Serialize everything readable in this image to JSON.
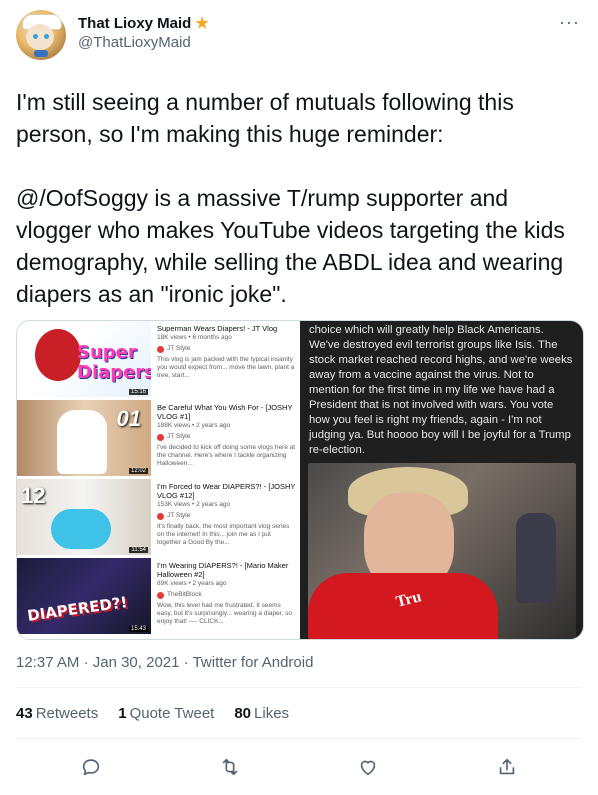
{
  "author": {
    "name": "That Lioxy Maid",
    "badge_icon": "star-icon",
    "handle": "@ThatLioxyMaid"
  },
  "more_icon": "more-icon",
  "tweet_text": "I'm still seeing a number of mutuals following this person, so I'm making this huge reminder:\n\n@/OofSoggy is a massive T/rump supporter and vlogger who makes YouTube videos targeting the kids demography, while selling the ABDL idea and wearing diapers as an \"ironic joke\".",
  "media": {
    "videos": [
      {
        "thumb_text": "Super Diapers!",
        "duration": "15:16",
        "title": "Superman Wears Diapers! - JT Vlog",
        "views": "18K views • 6 months ago",
        "channel": "JT Style",
        "desc": "This vlog is jam packed with the typical insanity you would expect from... move the lawn, plant a tree, start..."
      },
      {
        "thumb_text": "01",
        "duration": "12:02",
        "title": "Be Careful What You Wish For - [JOSHY VLOG #1]",
        "views": "188K views • 2 years ago",
        "channel": "JT Style",
        "desc": "I've decided to kick off doing some vlogs here at the channel. Here's where I tackle organizing Halloween..."
      },
      {
        "thumb_text": "12",
        "duration": "11:54",
        "title": "I'm Forced to Wear DIAPERS?! - [JOSHY VLOG #12]",
        "views": "153K views • 2 years ago",
        "channel": "JT Style",
        "desc": "It's finally back, the most important vlog series on the internet! In this... join me as I put together a Good By the..."
      },
      {
        "thumb_text": "DIAPERED?!",
        "duration": "15:43",
        "title": "I'm Wearing DIAPERS?! - [Mario Maker Halloween #2]",
        "views": "89K views • 2 years ago",
        "channel": "TheBitBlock",
        "desc": "Wow, this level had me frustrated. It seems easy, but it's surprisingly... wearing a diaper, so enjoy that! ---- CLICK..."
      }
    ],
    "post_text": "choice which will greatly help Black Americans. We've destroyed evil terrorist groups like Isis. The stock market reached record highs, and we're weeks away from a vaccine against the virus. Not to mention for the first time in my life we have had a President that is not involved with wars. You vote how you feel is right my friends, again - I'm not judging ya. But hoooo boy will I be joyful for a Trump re-election.",
    "shirt_text": "Tru"
  },
  "meta": {
    "time": "12:37 AM",
    "date": "Jan 30, 2021",
    "separator": "·",
    "source": "Twitter for Android"
  },
  "stats": {
    "retweets_count": "43",
    "retweets_label": "Retweets",
    "quotes_count": "1",
    "quotes_label": "Quote Tweet",
    "likes_count": "80",
    "likes_label": "Likes"
  },
  "actions": [
    "reply-icon",
    "retweet-icon",
    "like-icon",
    "share-icon"
  ],
  "colors": {
    "text": "#0f1419",
    "secondary": "#536471",
    "badge": "#f5a623",
    "divider": "#eff3f4"
  }
}
